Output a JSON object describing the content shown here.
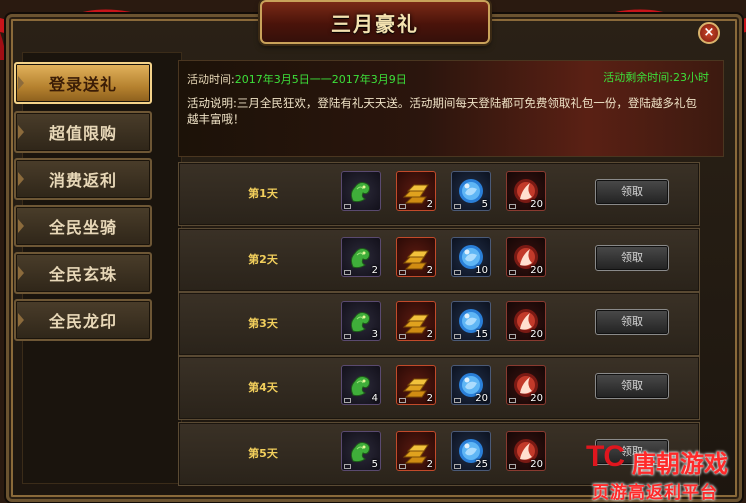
{
  "window": {
    "title": "三月豪礼",
    "close_glyph": "×"
  },
  "sidebar": {
    "items": [
      {
        "label": "登录送礼",
        "active": true
      },
      {
        "label": "超值限购",
        "active": false
      },
      {
        "label": "消费返利",
        "active": false
      },
      {
        "label": "全民坐骑",
        "active": false
      },
      {
        "label": "全民玄珠",
        "active": false
      },
      {
        "label": "全民龙印",
        "active": false
      }
    ]
  },
  "event": {
    "time_label": "活动时间:",
    "time_value": "2017年3月5日一一2017年3月9日",
    "remaining_label": "活动剩余时间:",
    "remaining_value": "23小时",
    "desc_label": "活动说明:",
    "desc_text": "三月全民狂欢，登陆有礼天天送。活动期间每天登陆都可免费领取礼包一份，登陆越多礼包越丰富哦！"
  },
  "days": [
    {
      "label": "第1天",
      "items": [
        {
          "icon": "jade-dragon-icon",
          "qty": ""
        },
        {
          "icon": "gold-bars-icon",
          "qty": "2"
        },
        {
          "icon": "blue-orb-icon",
          "qty": "5"
        },
        {
          "icon": "flame-orb-icon",
          "qty": "20"
        }
      ],
      "claim_label": "领取"
    },
    {
      "label": "第2天",
      "items": [
        {
          "icon": "jade-dragon-icon",
          "qty": "2"
        },
        {
          "icon": "gold-bars-icon",
          "qty": "2"
        },
        {
          "icon": "blue-orb-icon",
          "qty": "10"
        },
        {
          "icon": "flame-orb-icon",
          "qty": "20"
        }
      ],
      "claim_label": "领取"
    },
    {
      "label": "第3天",
      "items": [
        {
          "icon": "jade-dragon-icon",
          "qty": "3"
        },
        {
          "icon": "gold-bars-icon",
          "qty": "2"
        },
        {
          "icon": "blue-orb-icon",
          "qty": "15"
        },
        {
          "icon": "flame-orb-icon",
          "qty": "20"
        }
      ],
      "claim_label": "领取"
    },
    {
      "label": "第4天",
      "items": [
        {
          "icon": "jade-dragon-icon",
          "qty": "4"
        },
        {
          "icon": "gold-bars-icon",
          "qty": "2"
        },
        {
          "icon": "blue-orb-icon",
          "qty": "20"
        },
        {
          "icon": "flame-orb-icon",
          "qty": "20"
        }
      ],
      "claim_label": "领取"
    },
    {
      "label": "第5天",
      "items": [
        {
          "icon": "jade-dragon-icon",
          "qty": "5"
        },
        {
          "icon": "gold-bars-icon",
          "qty": "2"
        },
        {
          "icon": "blue-orb-icon",
          "qty": "25"
        },
        {
          "icon": "flame-orb-icon",
          "qty": "20"
        }
      ],
      "claim_label": "领取"
    }
  ],
  "watermark": {
    "logo": "TC",
    "name": "唐朝游戏",
    "slogan": "页游高返利平台"
  },
  "colors": {
    "accent_gold": "#f2cf5c",
    "highlight_green": "#3de03a",
    "ribbon_red": "#c8141a"
  }
}
